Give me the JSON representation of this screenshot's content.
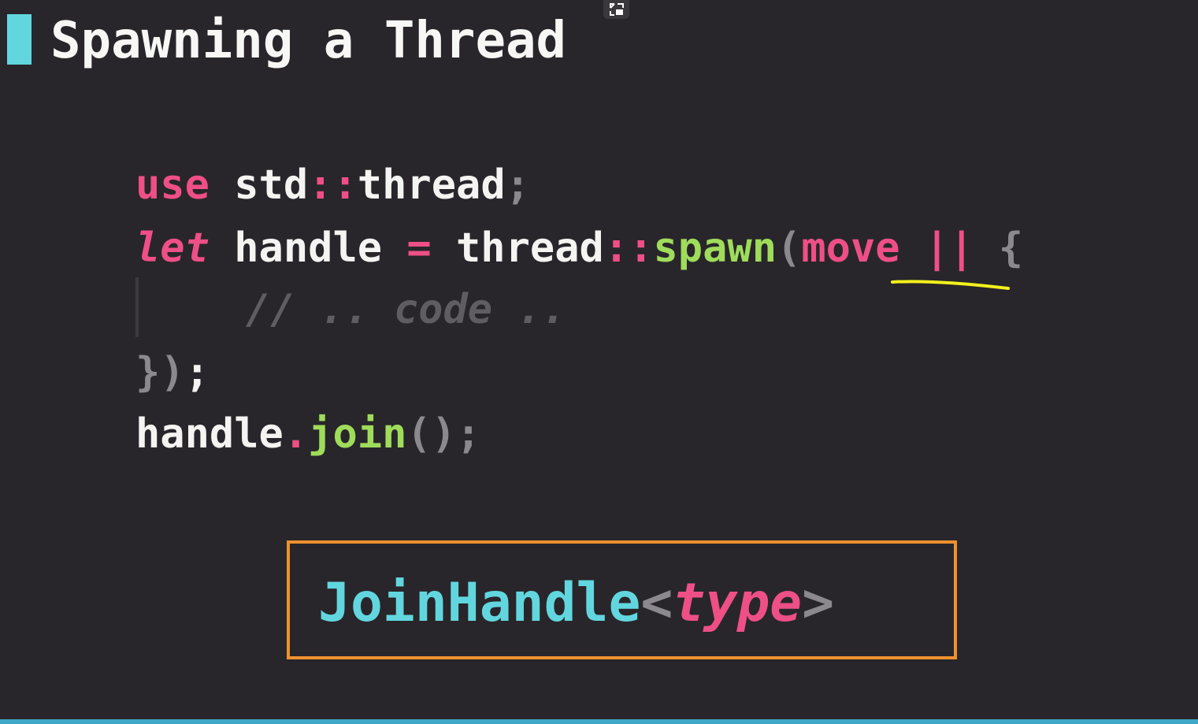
{
  "slide": {
    "title": "Spawning a Thread"
  },
  "code": {
    "line1": {
      "kw": "use",
      "path": " std",
      "sep": "::",
      "name": "thread",
      "semi": ";"
    },
    "line2": {
      "kw": "let",
      "var": " handle ",
      "eq": "=",
      "mod": " thread",
      "sep": "::",
      "fn": "spawn",
      "paren": "(",
      "move": "move",
      "pipes": " || ",
      "brace": "{"
    },
    "line3": {
      "comment": "// .. code .."
    },
    "line4": {
      "close": "})",
      "semi": ";"
    },
    "line5": {
      "var": "handle",
      "dot": ".",
      "fn": "join",
      "parens": "()",
      "semi": ";"
    }
  },
  "type_box": {
    "name": "JoinHandle",
    "open": "<",
    "param": "type",
    "close": ">"
  },
  "colors": {
    "background": "#28262a",
    "accent": "#62d6de",
    "keyword": "#ee4f86",
    "function": "#9fdc5b",
    "box_border": "#f0912e",
    "annotation": "#f4f01c"
  },
  "icons": {
    "fullscreen": "exit-fullscreen-icon"
  }
}
